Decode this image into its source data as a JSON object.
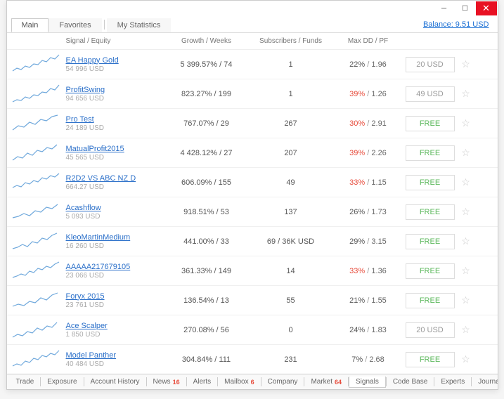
{
  "window": {
    "balance": "Balance: 9.51 USD"
  },
  "top_tabs": {
    "main": "Main",
    "favorites": "Favorites",
    "stats": "My Statistics"
  },
  "headers": {
    "signal": "Signal / Equity",
    "growth": "Growth / Weeks",
    "subs": "Subscribers / Funds",
    "dd": "Max DD / PF"
  },
  "rows": [
    {
      "name": "EA Happy Gold",
      "equity": "54 996 USD",
      "growth": "5 399.57% / 74",
      "subs": "1",
      "dd": "22%",
      "pf": "1.96",
      "dd_red": false,
      "price": "20 USD",
      "free": false
    },
    {
      "name": "ProfitSwing",
      "equity": "94 656 USD",
      "growth": "823.27% / 199",
      "subs": "1",
      "dd": "39%",
      "pf": "1.26",
      "dd_red": true,
      "price": "49 USD",
      "free": false
    },
    {
      "name": "Pro Test",
      "equity": "24 189 USD",
      "growth": "767.07% / 29",
      "subs": "267",
      "dd": "30%",
      "pf": "2.91",
      "dd_red": true,
      "price": "FREE",
      "free": true
    },
    {
      "name": "MatualProfit2015",
      "equity": "45 565 USD",
      "growth": "4 428.12% / 27",
      "subs": "207",
      "dd": "39%",
      "pf": "2.26",
      "dd_red": true,
      "price": "FREE",
      "free": true
    },
    {
      "name": "R2D2 VS ABC NZ D",
      "equity": "664.27 USD",
      "growth": "606.09% / 155",
      "subs": "49",
      "dd": "33%",
      "pf": "1.15",
      "dd_red": true,
      "price": "FREE",
      "free": true
    },
    {
      "name": "Acashflow",
      "equity": "5 093 USD",
      "growth": "918.51% / 53",
      "subs": "137",
      "dd": "26%",
      "pf": "1.73",
      "dd_red": false,
      "price": "FREE",
      "free": true
    },
    {
      "name": "KleoMartinMedium",
      "equity": "16 260 USD",
      "growth": "441.00% / 33",
      "subs": "69 / 36K USD",
      "dd": "29%",
      "pf": "3.15",
      "dd_red": false,
      "price": "FREE",
      "free": true
    },
    {
      "name": "AAAAA217679105",
      "equity": "23 066 USD",
      "growth": "361.33% / 149",
      "subs": "14",
      "dd": "33%",
      "pf": "1.36",
      "dd_red": true,
      "price": "FREE",
      "free": true
    },
    {
      "name": "Foryx 2015",
      "equity": "23 761 USD",
      "growth": "136.54% / 13",
      "subs": "55",
      "dd": "21%",
      "pf": "1.55",
      "dd_red": false,
      "price": "FREE",
      "free": true
    },
    {
      "name": "Ace Scalper",
      "equity": "1 850 USD",
      "growth": "270.08% / 56",
      "subs": "0",
      "dd": "24%",
      "pf": "1.83",
      "dd_red": false,
      "price": "20 USD",
      "free": false
    },
    {
      "name": "Model Panther",
      "equity": "40 484 USD",
      "growth": "304.84% / 111",
      "subs": "231",
      "dd": "7%",
      "pf": "2.68",
      "dd_red": false,
      "price": "FREE",
      "free": true
    }
  ],
  "bottom_tabs": [
    {
      "label": "Trade",
      "badge": ""
    },
    {
      "label": "Exposure",
      "badge": ""
    },
    {
      "label": "Account History",
      "badge": ""
    },
    {
      "label": "News",
      "badge": "16"
    },
    {
      "label": "Alerts",
      "badge": ""
    },
    {
      "label": "Mailbox",
      "badge": "6"
    },
    {
      "label": "Company",
      "badge": ""
    },
    {
      "label": "Market",
      "badge": "64"
    },
    {
      "label": "Signals",
      "badge": "",
      "active": true
    },
    {
      "label": "Code Base",
      "badge": ""
    },
    {
      "label": "Experts",
      "badge": ""
    },
    {
      "label": "Journal",
      "badge": ""
    }
  ]
}
